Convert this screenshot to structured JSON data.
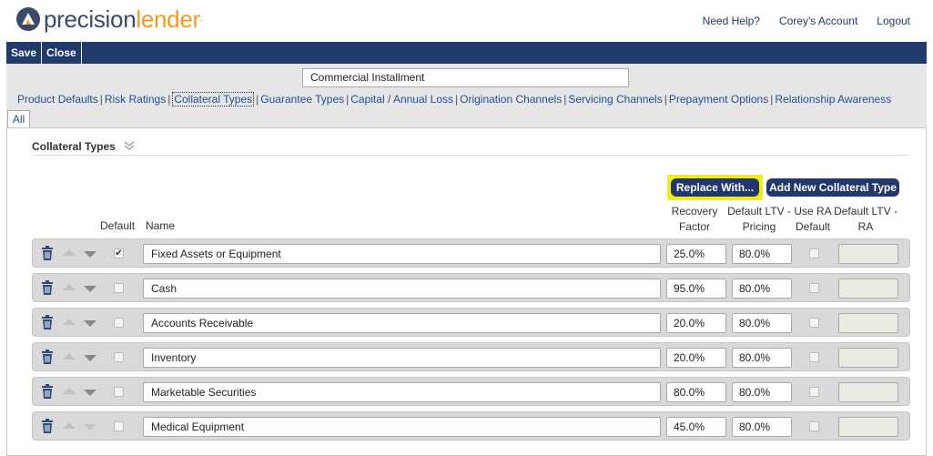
{
  "header": {
    "logo_part1": "precision",
    "logo_part2": "lender",
    "logo_dot": ".",
    "links": [
      "Need Help?",
      "Corey's Account",
      "Logout"
    ]
  },
  "toolbar": {
    "save_label": "Save",
    "close_label": "Close"
  },
  "product_name": "Commercial Installment",
  "nav": {
    "items": [
      "Product Defaults",
      "Risk Ratings",
      "Collateral Types",
      "Guarantee Types",
      "Capital / Annual Loss",
      "Origination Channels",
      "Servicing Channels",
      "Prepayment Options",
      "Relationship Awareness"
    ],
    "active_index": 2,
    "separator": "|"
  },
  "tab_label": "All",
  "section": {
    "title": "Collateral Types",
    "replace_label": "Replace With...",
    "add_label": "Add New Collateral Type"
  },
  "columns": {
    "default": "Default",
    "name": "Name",
    "recovery_line1": "Recovery",
    "recovery_line2": "Factor",
    "ltv_line1": "Default LTV -",
    "ltv_line2": "Pricing",
    "usera_line1": "Use RA",
    "usera_line2": "Default",
    "ltvra_line1": "Default LTV -",
    "ltvra_line2": "RA"
  },
  "rows": [
    {
      "name": "Fixed Assets or Equipment",
      "recovery": "25.0%",
      "ltv": "80.0%",
      "default": true,
      "down_disabled": false
    },
    {
      "name": "Cash",
      "recovery": "95.0%",
      "ltv": "80.0%",
      "default": false,
      "down_disabled": false
    },
    {
      "name": "Accounts Receivable",
      "recovery": "20.0%",
      "ltv": "80.0%",
      "default": false,
      "down_disabled": false
    },
    {
      "name": "Inventory",
      "recovery": "20.0%",
      "ltv": "80.0%",
      "default": false,
      "down_disabled": false
    },
    {
      "name": "Marketable Securities",
      "recovery": "80.0%",
      "ltv": "80.0%",
      "default": false,
      "down_disabled": false
    },
    {
      "name": "Medical Equipment",
      "recovery": "45.0%",
      "ltv": "80.0%",
      "default": false,
      "down_disabled": true
    }
  ],
  "colors": {
    "navy": "#1f3a6b",
    "orange": "#f39a1e",
    "link": "#1d4f97",
    "highlight": "#f5ea1a"
  },
  "icons": {
    "trash": "trash-icon",
    "up": "arrow-up-icon",
    "down": "arrow-down-icon",
    "collapse": "double-chevron-icon"
  }
}
